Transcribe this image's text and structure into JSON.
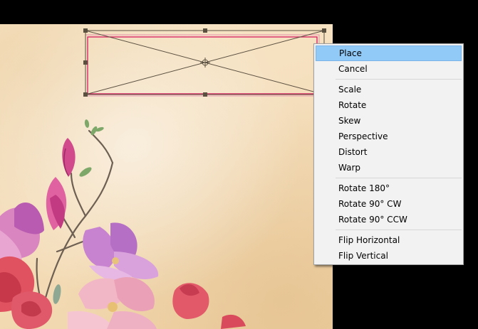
{
  "context_menu": {
    "highlighted": "Place",
    "groups": [
      [
        "Place",
        "Cancel"
      ],
      [
        "Scale",
        "Rotate",
        "Skew",
        "Perspective",
        "Distort",
        "Warp"
      ],
      [
        "Rotate 180°",
        "Rotate 90° CW",
        "Rotate 90° CCW"
      ],
      [
        "Flip Horizontal",
        "Flip Vertical"
      ]
    ]
  },
  "colors": {
    "page_background": "#000000",
    "parchment": "#f5dfbd",
    "menu_background": "#f2f2f2",
    "menu_highlight": "#91c9f7",
    "placeholder_frame": "#d81b60",
    "transform_lines": "#5a5040"
  },
  "icons": [
    "transform-handle-icon",
    "crosshair-center-icon"
  ]
}
